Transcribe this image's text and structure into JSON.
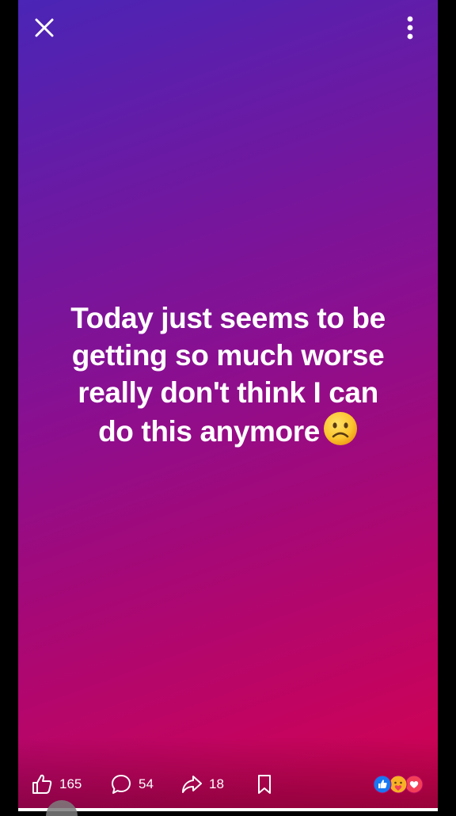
{
  "story": {
    "text": "Today just seems to be getting so much worse really don't think I can do this anymore",
    "text_lines": [
      "Today just seems to be",
      "getting so much worse",
      "really don't think I can",
      "do this anymore"
    ],
    "emoji": "frowning-face",
    "background_colors": [
      "#4a25b6",
      "#8a0f90",
      "#d4024f"
    ]
  },
  "actions": {
    "likes": "165",
    "comments": "54",
    "shares": "18"
  },
  "reactions": {
    "icons": [
      "like-reaction-icon",
      "care-reaction-icon",
      "love-reaction-icon"
    ]
  }
}
